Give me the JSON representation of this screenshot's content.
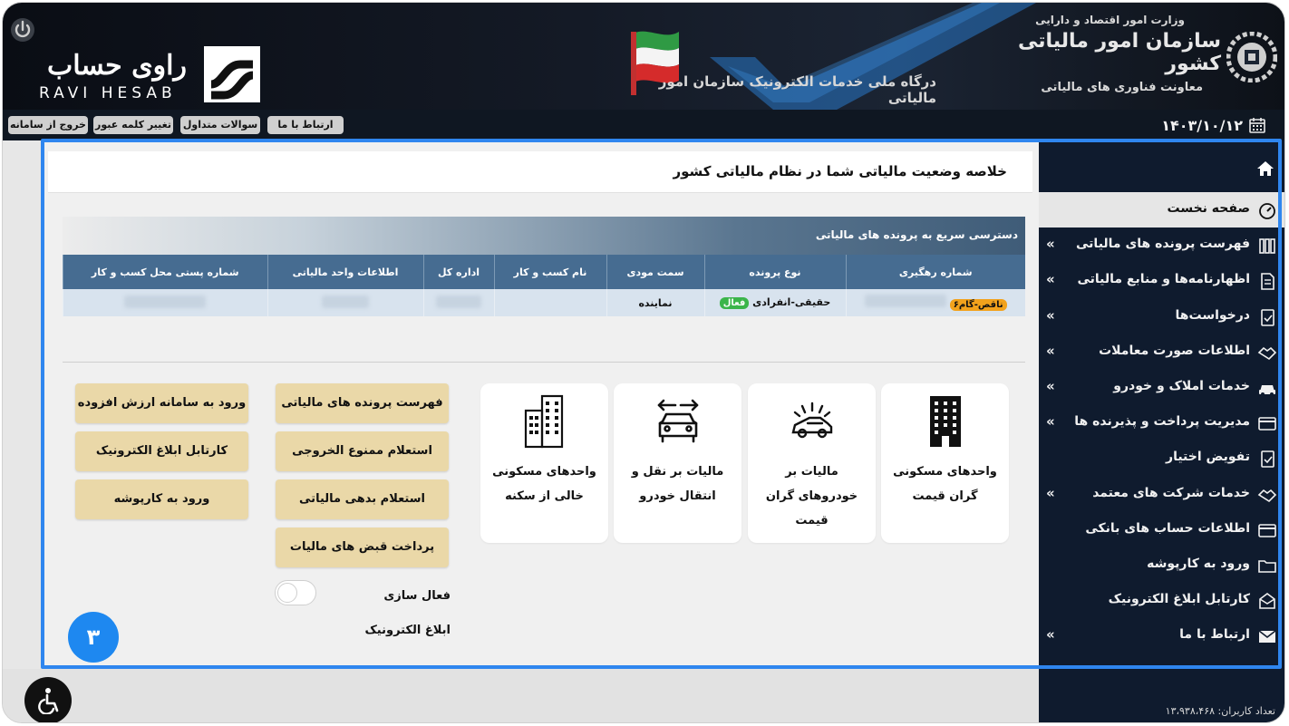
{
  "header": {
    "brand_fa": "راوی حساب",
    "brand_en": "RAVI HESAB",
    "portal_title": "درگاه ملی خدمات الکترونیک سازمان امور مالیاتی",
    "org_ministry": "وزارت امور اقتصاد و دارایی",
    "org_name": "سازمان امور مالیاتی کشور",
    "org_deputy": "معاونت فناوری های مالیاتی"
  },
  "toolbar": {
    "contact_label": "ارتباط با ما",
    "faq_label": "سوالات متداول",
    "change_password_label": "تغییر کلمه عبور",
    "logout_label": "خروج از سامانه",
    "date": "۱۴۰۳/۱۰/۱۲"
  },
  "sidebar": {
    "items": [
      {
        "label": "صفحه نخست",
        "icon": "dashboard-icon"
      },
      {
        "label": "فهرست پرونده های مالیاتی",
        "icon": "files-icon"
      },
      {
        "label": "اظهارنامه‌ها و منابع مالیاتی",
        "icon": "document-icon"
      },
      {
        "label": "درخواست‌ها",
        "icon": "request-icon"
      },
      {
        "label": "اطلاعات صورت معاملات",
        "icon": "handshake-icon"
      },
      {
        "label": "خدمات املاک و خودرو",
        "icon": "car-icon"
      },
      {
        "label": "مدیریت پرداخت و پذیرنده ها",
        "icon": "card-icon"
      },
      {
        "label": "تفویض اختیار",
        "icon": "delegate-icon"
      },
      {
        "label": "خدمات شرکت های معتمد",
        "icon": "trusted-icon"
      },
      {
        "label": "اطلاعات حساب های بانکی",
        "icon": "bank-card-icon"
      },
      {
        "label": "ورود به کارپوشه",
        "icon": "folder-icon"
      },
      {
        "label": "کارتابل ابلاغ الکترونیک",
        "icon": "mail-icon"
      },
      {
        "label": "ارتباط با ما",
        "icon": "envelope-icon"
      }
    ],
    "chevron": "»",
    "users_count": "تعداد کاربران: ۱۳،۹۳۸،۴۶۸"
  },
  "main": {
    "page_title": "خلاصه وضعیت مالیاتی شما در نظام مالیاتی کشور",
    "quick_access_label": "دسترسی سریع به پرونده های مالیاتی",
    "table": {
      "headers": [
        "شماره رهگیری",
        "نوع پرونده",
        "سمت مودی",
        "نام کسب و کار",
        "اداره کل",
        "اطلاعات واحد مالیاتی",
        "شماره پستی محل کسب و کار"
      ],
      "row": {
        "status_badge": "ناقص-گام۶",
        "case_type": "حقیقی-انفرادی",
        "active_badge": "فعال",
        "role": "نماینده"
      }
    },
    "cards": [
      {
        "label": "واحدهای مسکونی گران قیمت",
        "icon": "building-icon"
      },
      {
        "label": "مالیات بر خودروهای گران قیمت",
        "icon": "luxury-car-icon"
      },
      {
        "label": "مالیات بر نقل و انتقال خودرو",
        "icon": "car-transfer-icon"
      },
      {
        "label": "واحدهای مسکونی خالی از سکنه",
        "icon": "apartments-icon"
      }
    ],
    "actions_col1": [
      {
        "label": "فهرست پرونده های مالیاتی"
      },
      {
        "label": "استعلام ممنوع الخروجی"
      },
      {
        "label": "استعلام بدهی مالیاتی"
      },
      {
        "label": "پرداخت قبض های مالیات"
      }
    ],
    "actions_col2": [
      {
        "label": "ورود به سامانه ارزش افزوده"
      },
      {
        "label": "کارتابل ابلاغ الکترونیک"
      },
      {
        "label": "ورود به کارپوشه"
      }
    ],
    "toggle_label": "فعال سازی ابلاغ الکترونیک",
    "toggle_on": false,
    "step_number": "۳"
  },
  "colors": {
    "header_bg": "#0f1722",
    "sidebar_bg": "#0f1b2e",
    "table_header": "#466c91",
    "action_button": "#ead8a8",
    "highlight": "#2f86ef",
    "step_circle": "#1e88f0"
  }
}
